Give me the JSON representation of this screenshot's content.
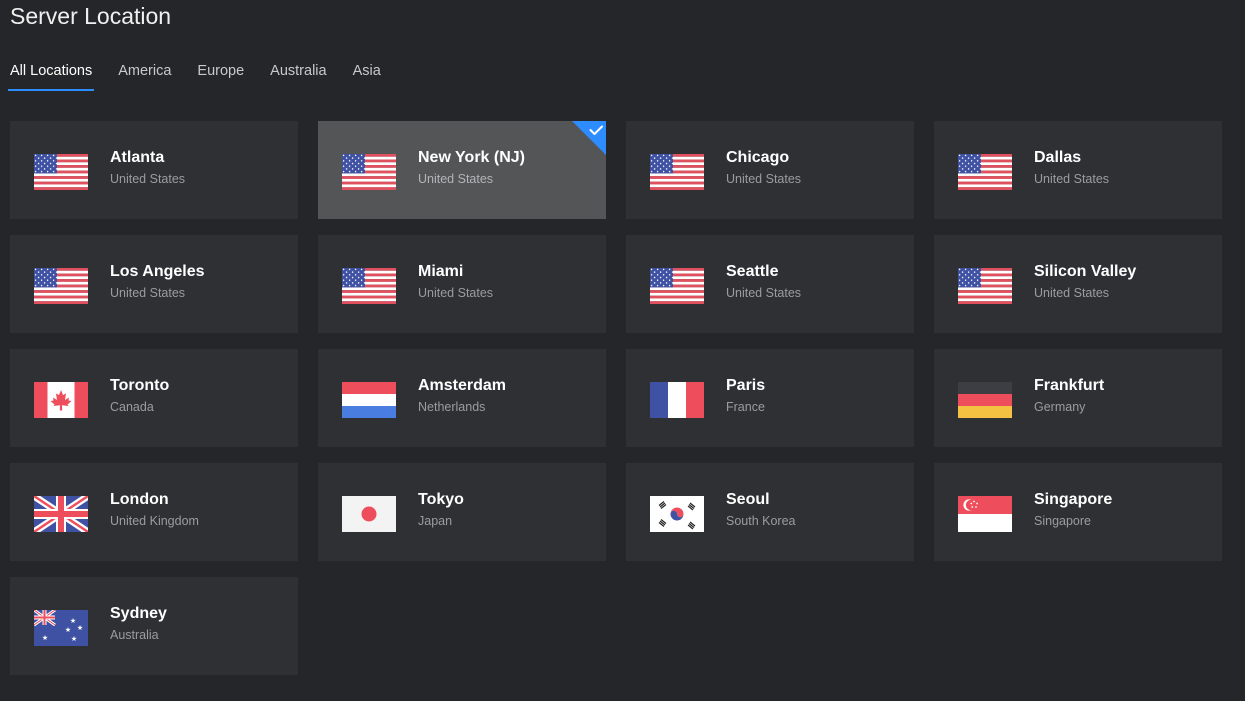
{
  "page": {
    "title": "Server Location"
  },
  "tabs": [
    {
      "label": "All Locations",
      "active": true
    },
    {
      "label": "America",
      "active": false
    },
    {
      "label": "Europe",
      "active": false
    },
    {
      "label": "Australia",
      "active": false
    },
    {
      "label": "Asia",
      "active": false
    }
  ],
  "colors": {
    "accent": "#2d8cff",
    "background": "#252629",
    "card": "#2f3034",
    "card_selected": "#545556"
  },
  "locations": [
    {
      "city": "Atlanta",
      "country": "United States",
      "flag": "us-flag-icon",
      "selected": false
    },
    {
      "city": "New York (NJ)",
      "country": "United States",
      "flag": "us-flag-icon",
      "selected": true
    },
    {
      "city": "Chicago",
      "country": "United States",
      "flag": "us-flag-icon",
      "selected": false
    },
    {
      "city": "Dallas",
      "country": "United States",
      "flag": "us-flag-icon",
      "selected": false
    },
    {
      "city": "Los Angeles",
      "country": "United States",
      "flag": "us-flag-icon",
      "selected": false
    },
    {
      "city": "Miami",
      "country": "United States",
      "flag": "us-flag-icon",
      "selected": false
    },
    {
      "city": "Seattle",
      "country": "United States",
      "flag": "us-flag-icon",
      "selected": false
    },
    {
      "city": "Silicon Valley",
      "country": "United States",
      "flag": "us-flag-icon",
      "selected": false
    },
    {
      "city": "Toronto",
      "country": "Canada",
      "flag": "canada-flag-icon",
      "selected": false
    },
    {
      "city": "Amsterdam",
      "country": "Netherlands",
      "flag": "netherlands-flag-icon",
      "selected": false
    },
    {
      "city": "Paris",
      "country": "France",
      "flag": "france-flag-icon",
      "selected": false
    },
    {
      "city": "Frankfurt",
      "country": "Germany",
      "flag": "germany-flag-icon",
      "selected": false
    },
    {
      "city": "London",
      "country": "United Kingdom",
      "flag": "uk-flag-icon",
      "selected": false
    },
    {
      "city": "Tokyo",
      "country": "Japan",
      "flag": "japan-flag-icon",
      "selected": false
    },
    {
      "city": "Seoul",
      "country": "South Korea",
      "flag": "south-korea-flag-icon",
      "selected": false
    },
    {
      "city": "Singapore",
      "country": "Singapore",
      "flag": "singapore-flag-icon",
      "selected": false
    },
    {
      "city": "Sydney",
      "country": "Australia",
      "flag": "australia-flag-icon",
      "selected": false
    }
  ]
}
